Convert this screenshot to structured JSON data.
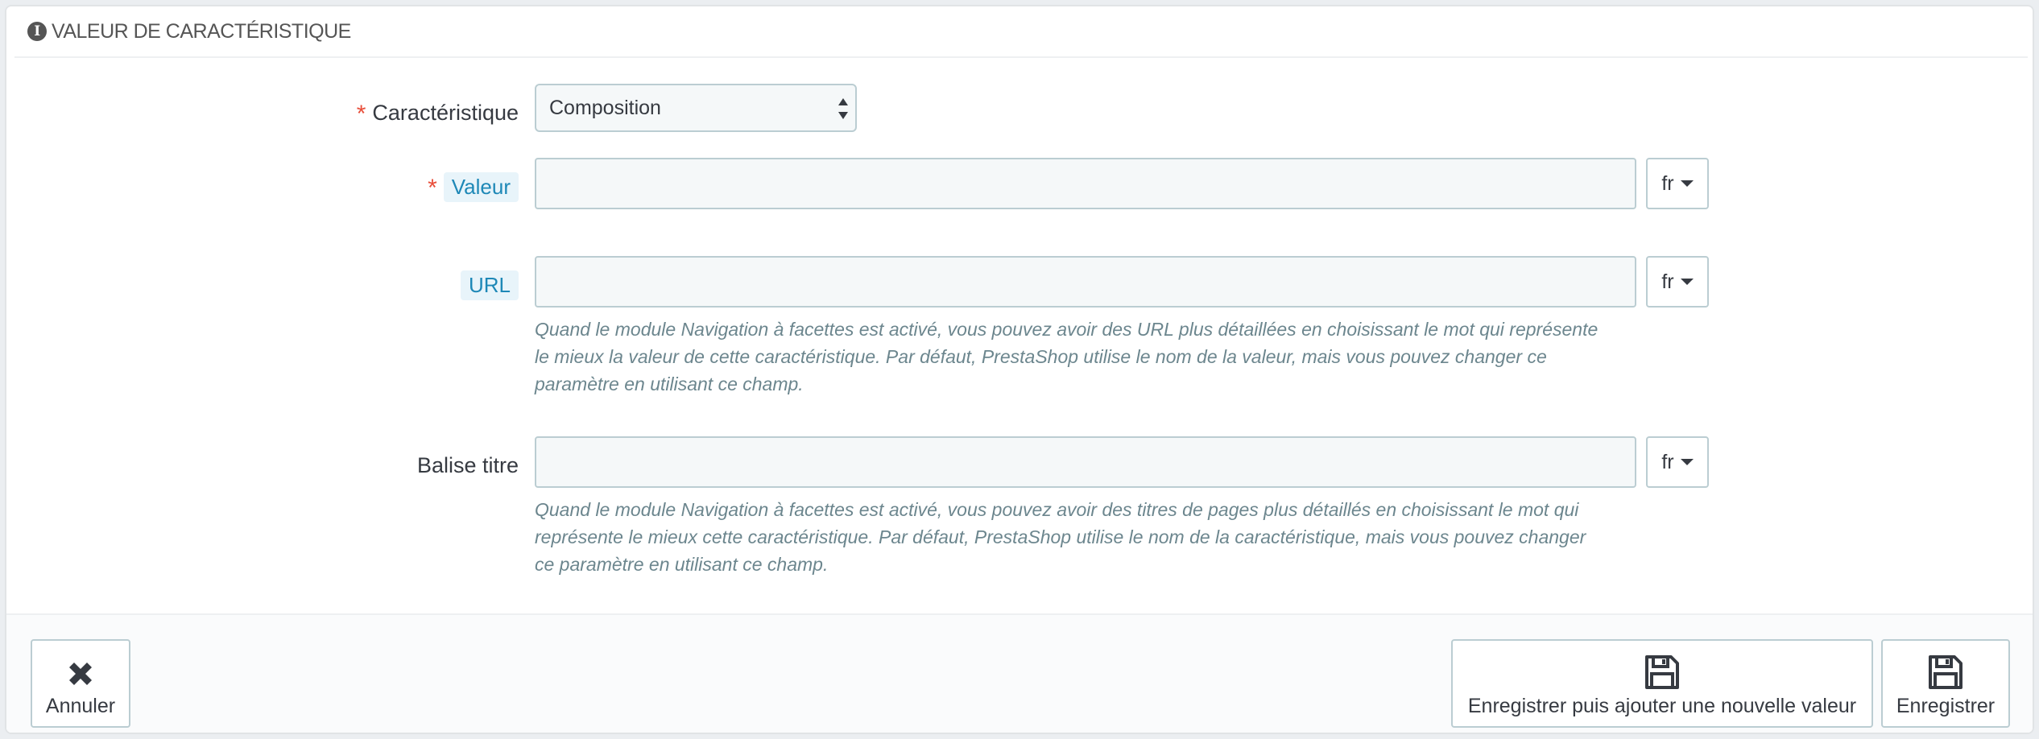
{
  "panel": {
    "title": "VALEUR DE CARACTÉRISTIQUE"
  },
  "form": {
    "feature": {
      "label": "Caractéristique",
      "required_mark": "*",
      "selected": "Composition"
    },
    "value": {
      "label": "Valeur",
      "required_mark": "*",
      "value": "",
      "lang": "fr"
    },
    "url": {
      "label": "URL",
      "value": "",
      "lang": "fr",
      "help_lines": [
        "Quand le module Navigation à facettes est activé, vous pouvez avoir des URL plus détaillées en choisissant le mot qui représente",
        "le mieux la valeur de cette caractéristique. Par défaut, PrestaShop utilise le nom de la valeur, mais vous pouvez changer ce",
        "paramètre en utilisant ce champ."
      ]
    },
    "meta_title": {
      "label": "Balise titre",
      "value": "",
      "lang": "fr",
      "help_lines": [
        "Quand le module Navigation à facettes est activé, vous pouvez avoir des titres de pages plus détaillés en choisissant le mot qui",
        "représente le mieux cette caractéristique. Par défaut, PrestaShop utilise le nom de la caractéristique, mais vous pouvez changer",
        "ce paramètre en utilisant ce champ."
      ]
    }
  },
  "footer": {
    "cancel_label": "Annuler",
    "save_and_add_label": "Enregistrer puis ajouter une nouvelle valeur",
    "save_label": "Enregistrer"
  },
  "icons": {
    "heading": "info-icon",
    "cancel": "close-icon",
    "save": "floppy-disk-icon"
  },
  "colors": {
    "required": "#e84e3a",
    "tip_bg": "#e8f4fa",
    "tip_text": "#1e88b7",
    "input_bg": "#f5f8f9",
    "input_border": "#bbcdd2"
  }
}
